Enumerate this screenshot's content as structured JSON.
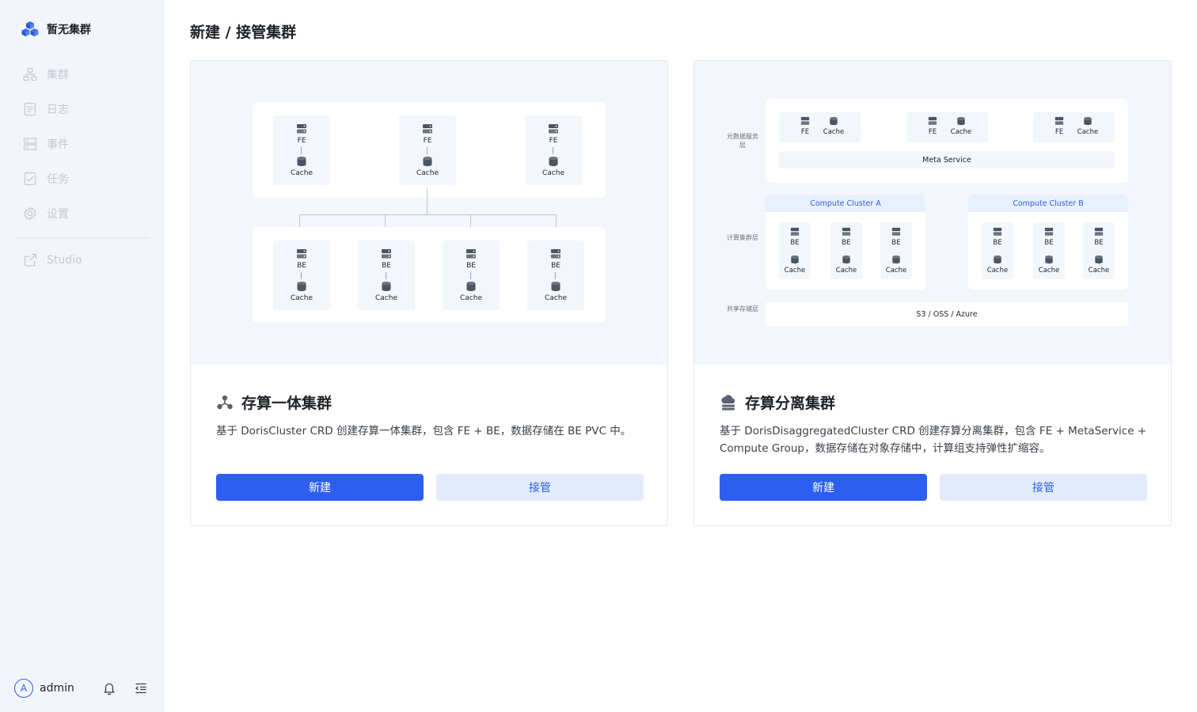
{
  "sidebar": {
    "brand_title": "暂无集群",
    "items": [
      {
        "label": "集群"
      },
      {
        "label": "日志"
      },
      {
        "label": "事件"
      },
      {
        "label": "任务"
      },
      {
        "label": "设置"
      }
    ],
    "studio_label": "Studio",
    "user": {
      "avatar_letter": "A",
      "name": "admin"
    }
  },
  "page": {
    "title": "新建 / 接管集群"
  },
  "cards": [
    {
      "title": "存算一体集群",
      "description": "基于 DorisCluster CRD 创建存算一体集群，包含 FE + BE，数据存储在 BE PVC 中。",
      "primary_label": "新建",
      "secondary_label": "接管",
      "diagram": {
        "fe_nodes": [
          {
            "role": "FE",
            "cache": "Cache"
          },
          {
            "role": "FE",
            "cache": "Cache"
          },
          {
            "role": "FE",
            "cache": "Cache"
          }
        ],
        "be_nodes": [
          {
            "role": "BE",
            "cache": "Cache"
          },
          {
            "role": "BE",
            "cache": "Cache"
          },
          {
            "role": "BE",
            "cache": "Cache"
          },
          {
            "role": "BE",
            "cache": "Cache"
          }
        ]
      }
    },
    {
      "title": "存算分离集群",
      "description": "基于 DorisDisaggregatedCluster CRD 创建存算分离集群，包含 FE + MetaService + Compute Group，数据存储在对象存储中，计算组支持弹性扩缩容。",
      "primary_label": "新建",
      "secondary_label": "接管",
      "diagram": {
        "layer_meta": "元数据服务层",
        "layer_compute": "计算集群层",
        "layer_storage": "共享存储层",
        "fe_nodes": [
          {
            "role": "FE",
            "cache": "Cache"
          },
          {
            "role": "FE",
            "cache": "Cache"
          },
          {
            "role": "FE",
            "cache": "Cache"
          }
        ],
        "meta_service": "Meta Service",
        "cluster_a": {
          "title": "Compute Cluster A",
          "nodes": [
            {
              "role": "BE",
              "cache": "Cache"
            },
            {
              "role": "BE",
              "cache": "Cache"
            },
            {
              "role": "BE",
              "cache": "Cache"
            }
          ]
        },
        "cluster_b": {
          "title": "Compute Cluster B",
          "nodes": [
            {
              "role": "BE",
              "cache": "Cache"
            },
            {
              "role": "BE",
              "cache": "Cache"
            },
            {
              "role": "BE",
              "cache": "Cache"
            }
          ]
        },
        "storage": "S3 / OSS / Azure"
      }
    }
  ],
  "colors": {
    "primary": "#2c5ff0",
    "sidebar_bg": "#f2f5fc",
    "hero_bg": "#f3f6fb",
    "secondary_btn_bg": "#e3ebfb"
  }
}
